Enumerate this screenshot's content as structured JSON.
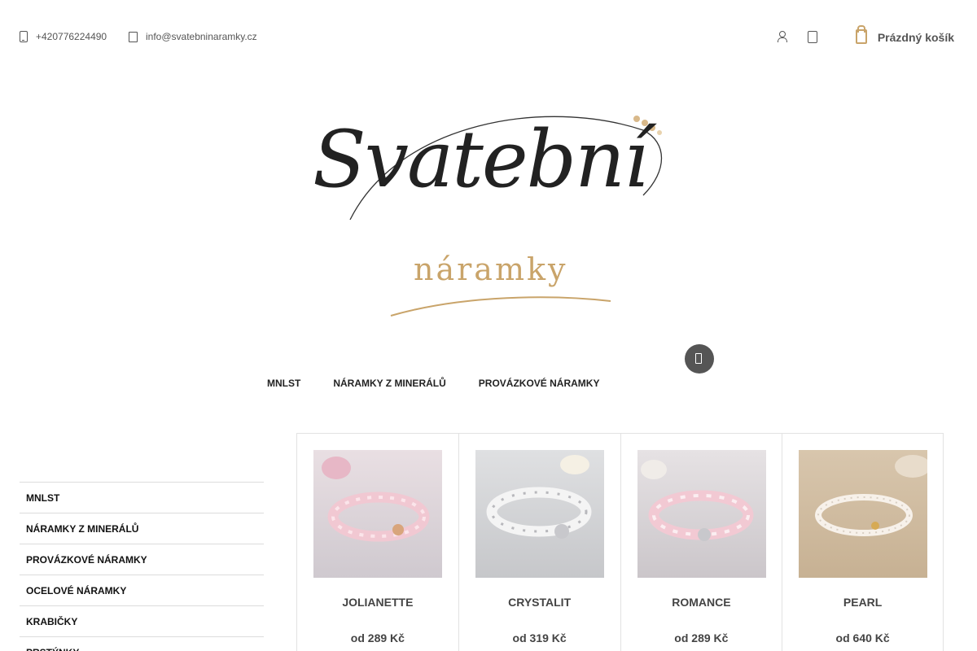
{
  "header": {
    "phone": "+420776224490",
    "email": "info@svatebninaramky.cz",
    "cart_label": "Prázdný košík",
    "icons": {
      "phone": "phone-icon",
      "email": "envelope-icon",
      "user": "user-icon",
      "wishlist": "heart-icon",
      "cart": "bag-icon",
      "search": "search-icon"
    }
  },
  "logo": {
    "script": "Svatební",
    "sub": "náramky"
  },
  "main_nav": [
    "MNLST",
    "NÁRAMKY Z MINERÁLŮ",
    "PROVÁZKOVÉ NÁRAMKY"
  ],
  "sidebar": [
    "MNLST",
    "NÁRAMKY Z MINERÁLŮ",
    "PROVÁZKOVÉ NÁRAMKY",
    "OCELOVÉ NÁRAMKY",
    "KRABIČKY",
    "PRSTÝNKY"
  ],
  "products": [
    {
      "name": "JOLIANETTE",
      "price": "od 289 Kč"
    },
    {
      "name": "CRYSTALIT",
      "price": "od 319 Kč"
    },
    {
      "name": "ROMANCE",
      "price": "od 289 Kč"
    },
    {
      "name": "PEARL",
      "price": "od 640 Kč"
    }
  ],
  "colors": {
    "accent_gold": "#c9a46a",
    "text_dark": "#222222",
    "search_button": "#555555"
  }
}
